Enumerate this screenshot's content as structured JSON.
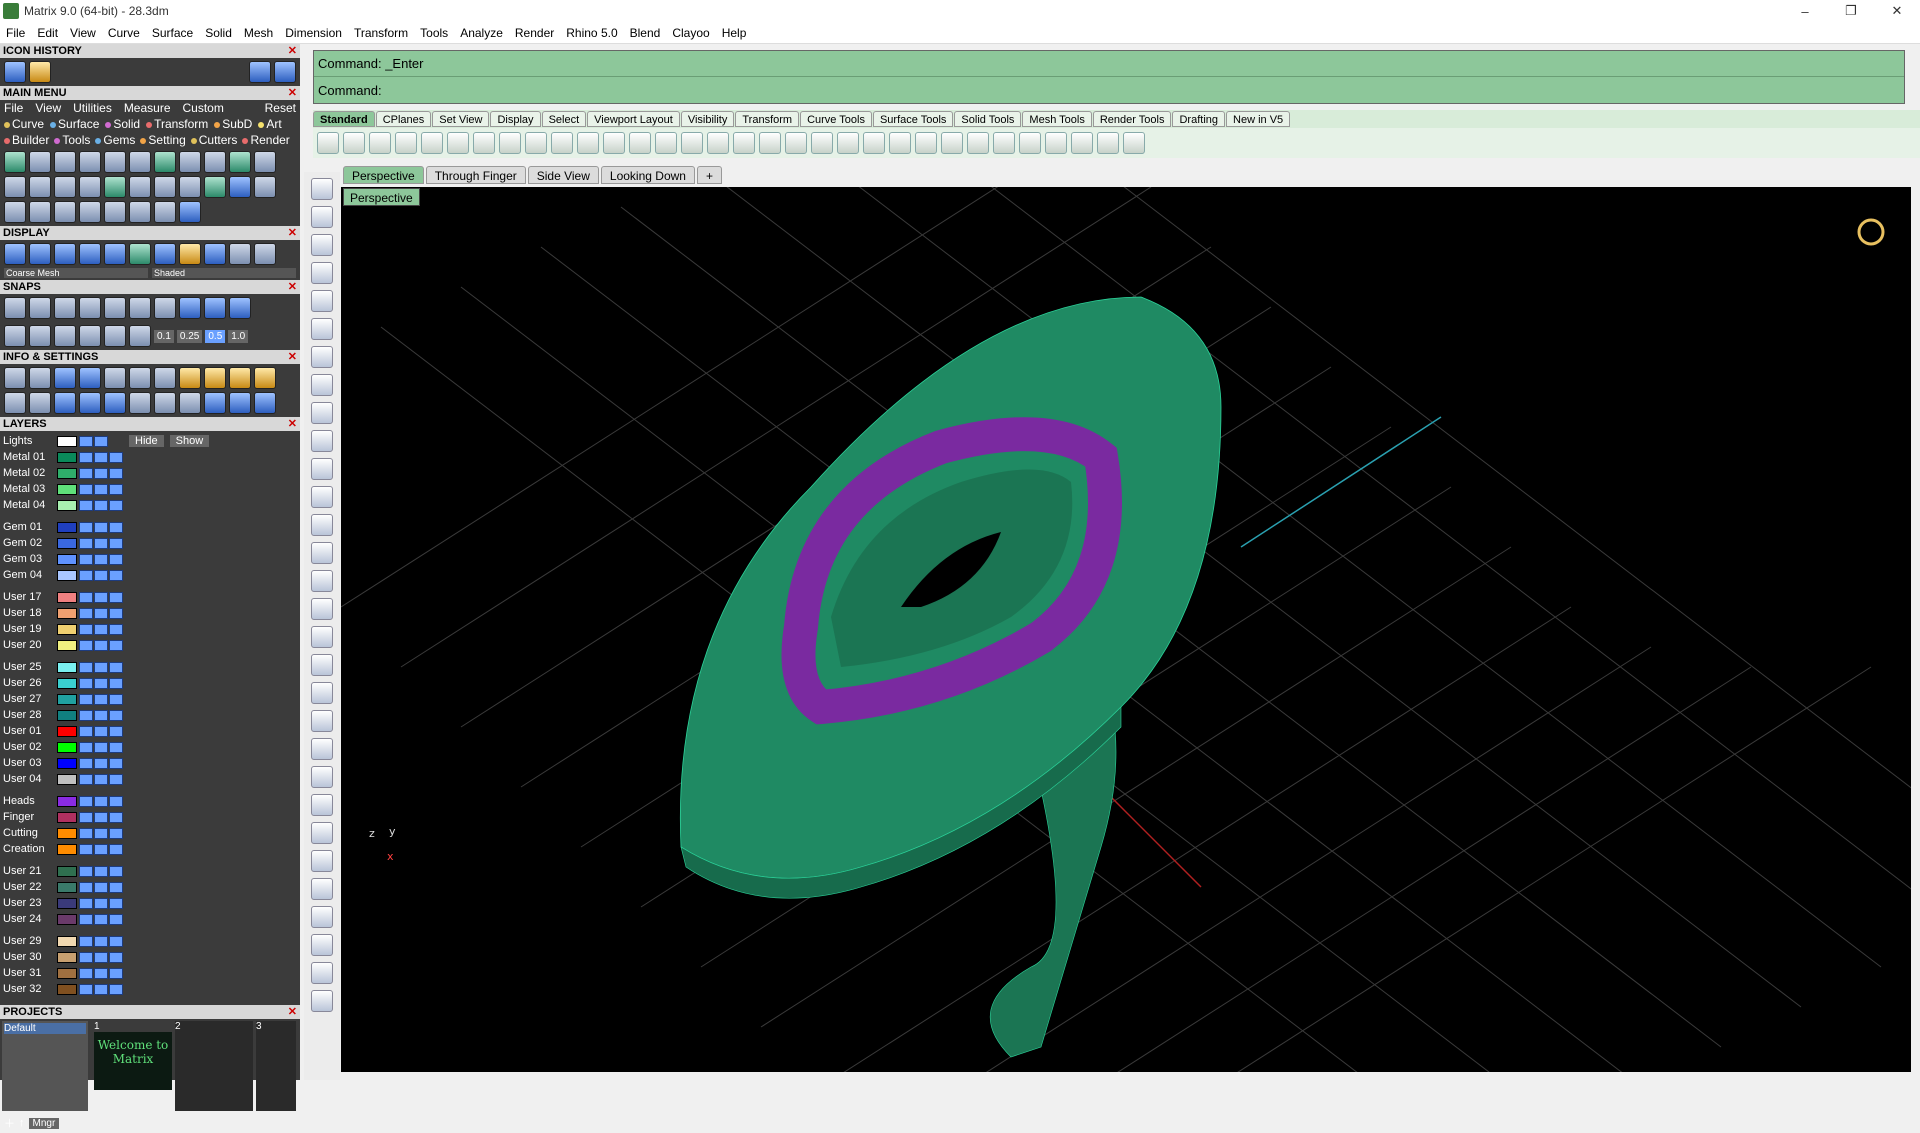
{
  "window": {
    "title": "Matrix 9.0 (64-bit) - 28.3dm",
    "controls": [
      "–",
      "❐",
      "✕"
    ]
  },
  "menubar": [
    "File",
    "Edit",
    "View",
    "Curve",
    "Surface",
    "Solid",
    "Mesh",
    "Dimension",
    "Transform",
    "Tools",
    "Analyze",
    "Render",
    "Rhino 5.0",
    "Blend",
    "Clayoo",
    "Help"
  ],
  "panels": {
    "icon_history": "ICON HISTORY",
    "main_menu": "MAIN MENU",
    "main_menu_items": [
      "File",
      "View",
      "Utilities",
      "Measure",
      "Custom",
      "Reset"
    ],
    "main_menu_row2": [
      {
        "label": "Curve",
        "color": "#e0c15a"
      },
      {
        "label": "Surface",
        "color": "#6ab0e6"
      },
      {
        "label": "Solid",
        "color": "#d16bd1"
      },
      {
        "label": "Transform",
        "color": "#e86c6c"
      },
      {
        "label": "SubD",
        "color": "#f2a447"
      },
      {
        "label": "Art",
        "color": "#f5e16d"
      }
    ],
    "main_menu_row3": [
      {
        "label": "Builder",
        "color": "#e86c6c"
      },
      {
        "label": "Tools",
        "color": "#d16bd1"
      },
      {
        "label": "Gems",
        "color": "#6ab0e6"
      },
      {
        "label": "Setting",
        "color": "#f2a447"
      },
      {
        "label": "Cutters",
        "color": "#e0c15a"
      },
      {
        "label": "Render",
        "color": "#e86c6c"
      }
    ],
    "display": "DISPLAY",
    "display_selects": [
      "Coarse Mesh",
      "Shaded"
    ],
    "snaps": "SNAPS",
    "snap_values": [
      "0.1",
      "0.25",
      "0.5",
      "1.0"
    ],
    "info_settings": "INFO & SETTINGS",
    "layers": "LAYERS",
    "lights_label": "Lights",
    "hide_label": "Hide",
    "show_label": "Show",
    "projects": "PROJECTS",
    "project_default": "Default",
    "project_slots": [
      "1",
      "2",
      "3"
    ],
    "welcome_text": "Welcome to Matrix",
    "mngr_label": "Mngr"
  },
  "layers_left": [
    {
      "name": "Metal 01",
      "color": "#0a8a5a"
    },
    {
      "name": "Metal 02",
      "color": "#2fae6a"
    },
    {
      "name": "Metal 03",
      "color": "#5fe07a"
    },
    {
      "name": "Metal 04",
      "color": "#a8f0b0"
    },
    {
      "name": "Gem 01",
      "color": "#1f3fbf"
    },
    {
      "name": "Gem 02",
      "color": "#3a68e0"
    },
    {
      "name": "Gem 03",
      "color": "#5f92ff"
    },
    {
      "name": "Gem 04",
      "color": "#a9c6ff"
    },
    {
      "name": "User 17",
      "color": "#f08080"
    },
    {
      "name": "User 18",
      "color": "#f0a070"
    },
    {
      "name": "User 19",
      "color": "#f0d070"
    },
    {
      "name": "User 20",
      "color": "#f0f080"
    },
    {
      "name": "User 25",
      "color": "#7af0f0"
    },
    {
      "name": "User 26",
      "color": "#3ad0d0"
    },
    {
      "name": "User 27",
      "color": "#20a0a0"
    },
    {
      "name": "User 28",
      "color": "#108080"
    }
  ],
  "layers_right": [
    {
      "name": "User 01",
      "color": "#ff0000"
    },
    {
      "name": "User 02",
      "color": "#00ff00"
    },
    {
      "name": "User 03",
      "color": "#0000ff"
    },
    {
      "name": "User 04",
      "color": "#c0c0c0"
    },
    {
      "name": "Heads",
      "color": "#8a2be2"
    },
    {
      "name": "Finger",
      "color": "#b03060"
    },
    {
      "name": "Cutting",
      "color": "#ff8c00"
    },
    {
      "name": "Creation",
      "color": "#ff8c00"
    },
    {
      "name": "User 21",
      "color": "#2f6f4f"
    },
    {
      "name": "User 22",
      "color": "#3a7a6a"
    },
    {
      "name": "User 23",
      "color": "#3a3a7a"
    },
    {
      "name": "User 24",
      "color": "#6a3a6a"
    },
    {
      "name": "User 29",
      "color": "#f0d8b0"
    },
    {
      "name": "User 30",
      "color": "#c8a070"
    },
    {
      "name": "User 31",
      "color": "#a07040"
    },
    {
      "name": "User 32",
      "color": "#805020"
    }
  ],
  "command": {
    "line1": "Command: _Enter",
    "line2": "Command:"
  },
  "toolbar_tabs": [
    "Standard",
    "CPlanes",
    "Set View",
    "Display",
    "Select",
    "Viewport Layout",
    "Visibility",
    "Transform",
    "Curve Tools",
    "Surface Tools",
    "Solid Tools",
    "Mesh Tools",
    "Render Tools",
    "Drafting",
    "New in V5"
  ],
  "viewport_tabs": [
    "Perspective",
    "Through Finger",
    "Side View",
    "Looking Down",
    "+"
  ],
  "viewport_label": "Perspective",
  "axis_labels": {
    "z": "z",
    "y": "y",
    "x": "x"
  },
  "colors": {
    "command_bg": "#8dc79a",
    "ring_band": "#1f8a63",
    "ring_bezel": "#7a2aa0",
    "grid": "#3a3a3a"
  }
}
